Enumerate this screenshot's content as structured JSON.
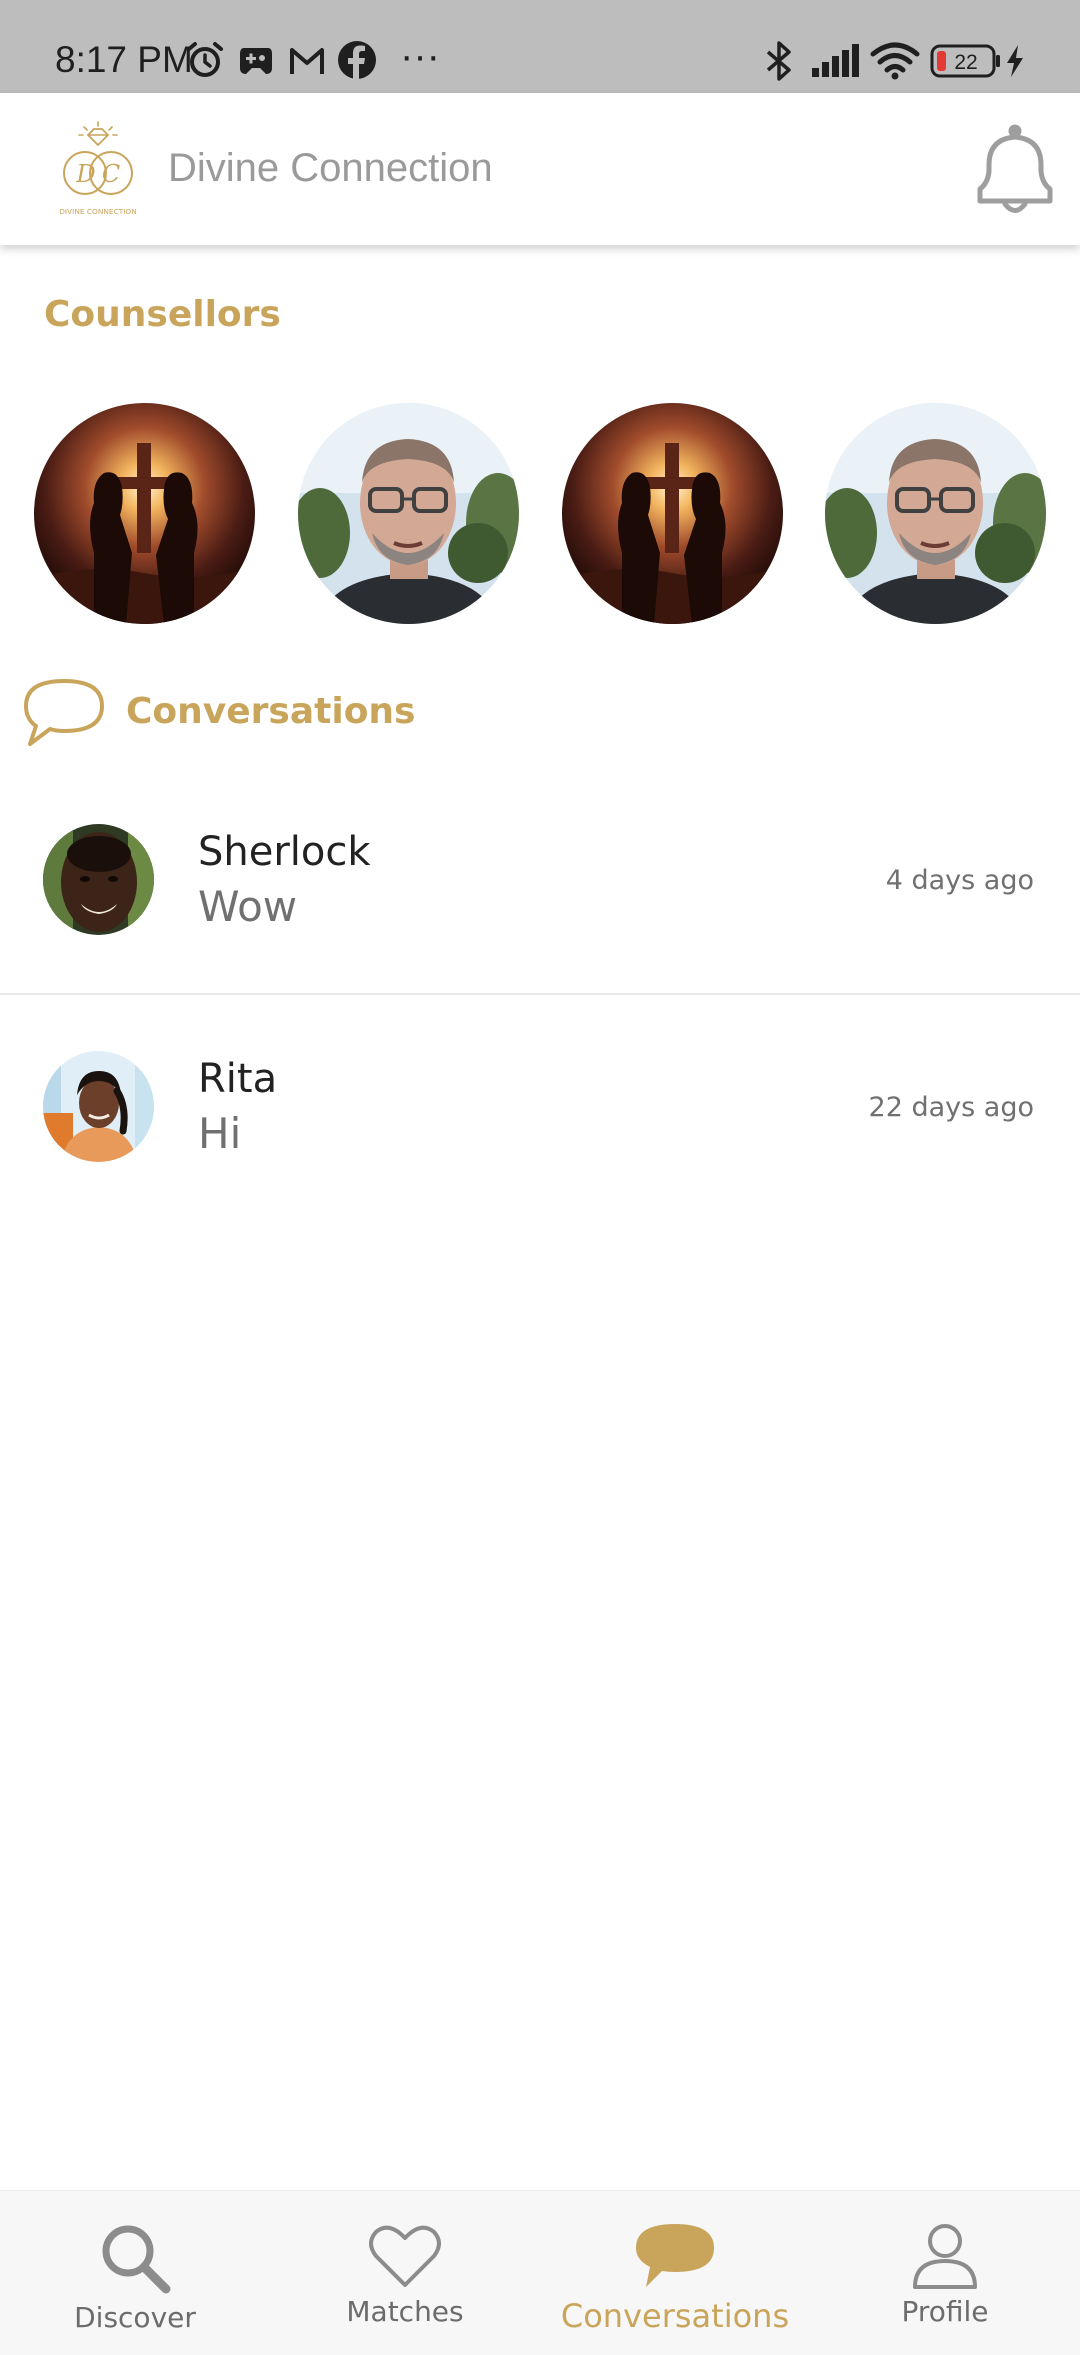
{
  "status_bar": {
    "time": "8:17 PM",
    "battery": "22",
    "more": "···",
    "icons": [
      "alarm-icon",
      "game-controller-icon",
      "gmail-icon",
      "facebook-icon",
      "more-icon",
      "bluetooth-icon",
      "signal-icon",
      "wifi-icon",
      "battery-icon",
      "charging-icon"
    ]
  },
  "header": {
    "title": "Divine Connection",
    "logo_text": "DIVINE CONNECTION",
    "logo_initials": "DC"
  },
  "counsellors": {
    "title": "Counsellors"
  },
  "conversations": {
    "title": "Conversations",
    "items": [
      {
        "name": "Sherlock",
        "message": "Wow",
        "time": "4 days ago"
      },
      {
        "name": "Rita",
        "message": "Hi",
        "time": "22 days ago"
      }
    ]
  },
  "nav": {
    "items": [
      {
        "label": "Discover",
        "icon": "search-icon"
      },
      {
        "label": "Matches",
        "icon": "heart-icon"
      },
      {
        "label": "Conversations",
        "icon": "chat-bubble-icon"
      },
      {
        "label": "Profile",
        "icon": "person-icon"
      }
    ],
    "active": "Conversations"
  },
  "colors": {
    "accent": "#c9a55c",
    "status_bar": "#bdbdbd",
    "title_gray": "#9a9a9a",
    "battery_low": "#e53935"
  }
}
